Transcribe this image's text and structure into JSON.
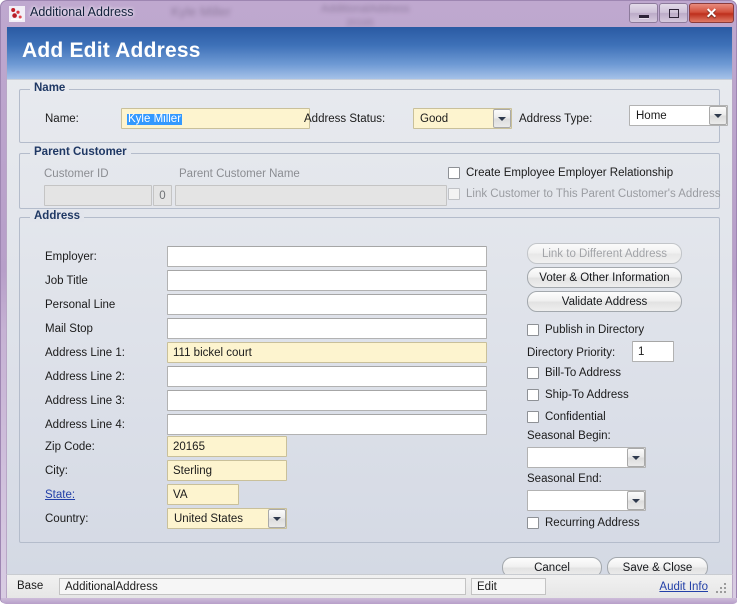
{
  "window": {
    "title": "Additional Address",
    "icon": "app-icon",
    "controls": {
      "minimize": "minimize-icon",
      "restore": "restore-icon",
      "close": "close-icon"
    },
    "ghost_texts": [
      "Kyle  Miller",
      "AdditionalAddress",
      "20165"
    ]
  },
  "banner": {
    "title": "Add Edit Address"
  },
  "name_group": {
    "legend": "Name",
    "name_label": "Name:",
    "name_value": "Kyle Miller",
    "address_status_label": "Address Status:",
    "address_status_value": "Good",
    "address_type_label": "Address Type:",
    "address_type_value": "Home"
  },
  "parent_group": {
    "legend": "Parent Customer",
    "customer_id_label": "Customer ID",
    "customer_id_value": "",
    "counter_value": "0",
    "parent_name_label": "Parent Customer Name",
    "parent_name_value": "",
    "create_rel_label": "Create Employee Employer Relationship",
    "link_customer_label": "Link Customer to This Parent Customer's Address"
  },
  "address_group": {
    "legend": "Address",
    "fields": [
      {
        "label": "Employer:",
        "value": "",
        "highlight": false
      },
      {
        "label": "Job Title",
        "value": "",
        "highlight": false
      },
      {
        "label": "Personal Line",
        "value": "",
        "highlight": false
      },
      {
        "label": "Mail Stop",
        "value": "",
        "highlight": false
      },
      {
        "label": "Address Line 1:",
        "value": "111 bickel court",
        "highlight": true
      },
      {
        "label": "Address Line 2:",
        "value": "",
        "highlight": false
      },
      {
        "label": "Address Line 3:",
        "value": "",
        "highlight": false
      },
      {
        "label": "Address Line 4:",
        "value": "",
        "highlight": false
      }
    ],
    "zip_label": "Zip Code:",
    "zip_value": "20165",
    "city_label": "City:",
    "city_value": "Sterling",
    "state_label": "State:",
    "state_value": "VA",
    "country_label": "Country:",
    "country_value": "United States",
    "buttons": [
      {
        "label": "Link to Different Address",
        "disabled": true
      },
      {
        "label": "Voter & Other Information",
        "disabled": false
      },
      {
        "label": "Validate Address",
        "disabled": false
      }
    ],
    "publish_label": "Publish in Directory",
    "priority_label": "Directory Priority:",
    "priority_value": "1",
    "billto_label": "Bill-To Address",
    "shipto_label": "Ship-To Address",
    "confidential_label": "Confidential",
    "seasonal_begin_label": "Seasonal Begin:",
    "seasonal_begin_value": "",
    "seasonal_end_label": "Seasonal End:",
    "seasonal_end_value": "",
    "recurring_label": "Recurring Address"
  },
  "footer": {
    "cancel_label": "Cancel",
    "save_label": "Save & Close"
  },
  "statusbar": {
    "base_label": "Base",
    "form_name": "AdditionalAddress",
    "mode": "Edit",
    "audit_link": "Audit Info"
  },
  "colors": {
    "accent_banner_top": "#2a5aa3",
    "accent_banner_bottom": "#a6c2e8",
    "frame": "#b79fc9",
    "required_field": "#fdf4cf",
    "link": "#2340a8",
    "selection": "#3399ff"
  }
}
